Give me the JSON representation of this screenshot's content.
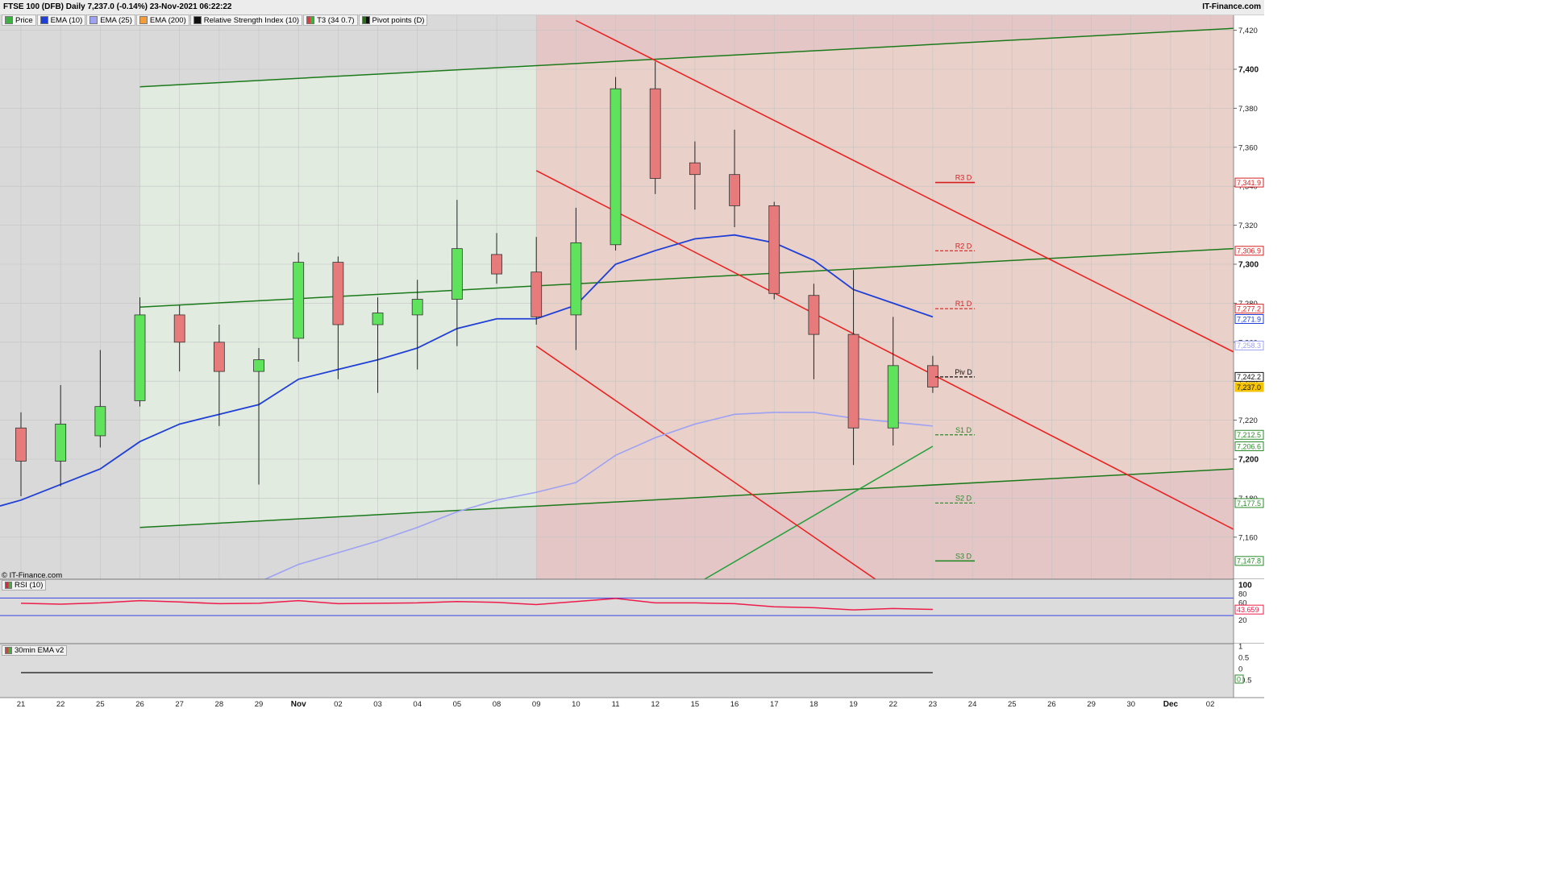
{
  "header": {
    "title": "FTSE 100 (DFB) Daily 7,237.0 (-0.14%) 23-Nov-2021 06:22:22",
    "brand": "IT-Finance.com"
  },
  "legend": [
    {
      "label": "Price",
      "color": "#3cb043"
    },
    {
      "label": "EMA (10)",
      "color": "#1f3fd6"
    },
    {
      "label": "EMA (25)",
      "color": "#9ea2f2"
    },
    {
      "label": "EMA (200)",
      "color": "#f39c3a"
    },
    {
      "label": "Relative Strength Index (10)",
      "color": "#111111"
    },
    {
      "label": "T3 (34 0.7)",
      "color": "#d64040"
    },
    {
      "label": "Pivot points (D)",
      "color": "#2a6e1a"
    }
  ],
  "copyright": "© IT-Finance.com",
  "rsi_panel_label": "RSI (10)",
  "ema_panel_label": "30min EMA v2",
  "colors": {
    "bull": "#5fe35c",
    "bear": "#e77b7b",
    "ema10": "#1f3fd6",
    "ema25": "#9ea2f2",
    "uptrend": "#1a7a1a",
    "downtrend": "#ee1c1c",
    "rsi": "#ee1c4a"
  },
  "chart_data": [
    {
      "type": "candlestick",
      "title": "FTSE 100 (DFB) Daily",
      "categories": [
        "21",
        "22",
        "25",
        "26",
        "27",
        "28",
        "29",
        "Nov",
        "02",
        "03",
        "04",
        "05",
        "08",
        "09",
        "10",
        "11",
        "12",
        "15",
        "16",
        "17",
        "18",
        "19",
        "22",
        "23",
        "24",
        "25",
        "26",
        "29",
        "30",
        "Dec",
        "02"
      ],
      "ylim": [
        7100,
        7425
      ],
      "yticks": [
        "7,160",
        "7,180",
        "7,200",
        "7,220",
        "7,240",
        "7,260",
        "7,280",
        "7,300",
        "7,320",
        "7,340",
        "7,360",
        "7,380",
        "7,400",
        "7,420"
      ],
      "candles": [
        {
          "date": "21",
          "open": 7216,
          "high": 7224,
          "low": 7181,
          "close": 7199
        },
        {
          "date": "22",
          "open": 7199,
          "high": 7238,
          "low": 7186,
          "close": 7218
        },
        {
          "date": "25",
          "open": 7212,
          "high": 7256,
          "low": 7206,
          "close": 7227
        },
        {
          "date": "26",
          "open": 7230,
          "high": 7283,
          "low": 7227,
          "close": 7274
        },
        {
          "date": "27",
          "open": 7274,
          "high": 7279,
          "low": 7245,
          "close": 7260
        },
        {
          "date": "28",
          "open": 7260,
          "high": 7269,
          "low": 7217,
          "close": 7245
        },
        {
          "date": "29",
          "open": 7245,
          "high": 7257,
          "low": 7187,
          "close": 7251
        },
        {
          "date": "Nov",
          "open": 7262,
          "high": 7306,
          "low": 7250,
          "close": 7301
        },
        {
          "date": "02",
          "open": 7301,
          "high": 7304,
          "low": 7241,
          "close": 7269
        },
        {
          "date": "03",
          "open": 7269,
          "high": 7283,
          "low": 7234,
          "close": 7275
        },
        {
          "date": "04",
          "open": 7274,
          "high": 7292,
          "low": 7246,
          "close": 7282
        },
        {
          "date": "05",
          "open": 7282,
          "high": 7333,
          "low": 7258,
          "close": 7308
        },
        {
          "date": "08",
          "open": 7305,
          "high": 7316,
          "low": 7290,
          "close": 7295
        },
        {
          "date": "09",
          "open": 7296,
          "high": 7314,
          "low": 7269,
          "close": 7273
        },
        {
          "date": "10",
          "open": 7274,
          "high": 7329,
          "low": 7256,
          "close": 7311
        },
        {
          "date": "11",
          "open": 7310,
          "high": 7396,
          "low": 7307,
          "close": 7390
        },
        {
          "date": "12",
          "open": 7390,
          "high": 7404,
          "low": 7336,
          "close": 7344
        },
        {
          "date": "15",
          "open": 7352,
          "high": 7363,
          "low": 7328,
          "close": 7346
        },
        {
          "date": "16",
          "open": 7346,
          "high": 7369,
          "low": 7319,
          "close": 7330
        },
        {
          "date": "17",
          "open": 7330,
          "high": 7332,
          "low": 7282,
          "close": 7285
        },
        {
          "date": "18",
          "open": 7284,
          "high": 7290,
          "low": 7241,
          "close": 7264
        },
        {
          "date": "19",
          "open": 7264,
          "high": 7297,
          "low": 7197,
          "close": 7216
        },
        {
          "date": "22",
          "open": 7216,
          "high": 7273,
          "low": 7207,
          "close": 7248
        },
        {
          "date": "23",
          "open": 7248,
          "high": 7253,
          "low": 7234,
          "close": 7237
        }
      ],
      "series": [
        {
          "name": "EMA (10)",
          "values": [
            7179,
            7187,
            7195,
            7209,
            7218,
            7223,
            7228,
            7241,
            7246,
            7251,
            7257,
            7267,
            7272,
            7272,
            7279,
            7300,
            7307,
            7313,
            7315,
            7311,
            7302,
            7287,
            7280,
            7273
          ]
        },
        {
          "name": "EMA (25)",
          "values": [
            7090,
            7095,
            7108,
            7117,
            7124,
            7131,
            7137,
            7146,
            7152,
            7158,
            7165,
            7173,
            7179,
            7183,
            7188,
            7202,
            7211,
            7218,
            7223,
            7224,
            7224,
            7221,
            7219,
            7217
          ]
        }
      ],
      "pivot_levels": [
        {
          "label": "R3 D",
          "value": 7341.9
        },
        {
          "label": "R2 D",
          "value": 7306.9
        },
        {
          "label": "R1 D",
          "value": 7277.2
        },
        {
          "label": "Piv D",
          "value": 7242.2
        },
        {
          "label": "S1 D",
          "value": 7212.5
        },
        {
          "label": "S2 D",
          "value": 7177.5
        },
        {
          "label": "S3 D",
          "value": 7147.8
        }
      ],
      "price_tags": [
        {
          "value": "7,341.9",
          "color": "#d62020"
        },
        {
          "value": "7,306.9",
          "color": "#d62020"
        },
        {
          "value": "7,277.2",
          "color": "#d62020"
        },
        {
          "value": "7,271.9",
          "color": "#1f3fd6"
        },
        {
          "value": "7,258.3",
          "color": "#9ea2f2"
        },
        {
          "value": "7,242.2",
          "color": "#111111"
        },
        {
          "value": "7,237.0",
          "color": "#f0c000"
        },
        {
          "value": "7,212.5",
          "color": "#2a8a2a"
        },
        {
          "value": "7,206.6",
          "color": "#2a8a2a"
        },
        {
          "value": "7,177.5",
          "color": "#2a8a2a"
        },
        {
          "value": "7,147.8",
          "color": "#2a8a2a"
        }
      ]
    },
    {
      "type": "line",
      "title": "RSI (10)",
      "ylim": [
        0,
        100
      ],
      "yticks": [
        "100",
        "80",
        "60",
        "40",
        "20"
      ],
      "reference_lines": [
        70,
        30
      ],
      "current_value": "43.659",
      "values": [
        58,
        56,
        59,
        64,
        61,
        57,
        58,
        64,
        57,
        58,
        59,
        62,
        60,
        55,
        62,
        69,
        59,
        59,
        57,
        50,
        48,
        43,
        46,
        44
      ]
    },
    {
      "type": "line",
      "title": "30min EMA v2",
      "yticks": [
        "1",
        "0.5",
        "0",
        "-0.5"
      ],
      "current_value": "0",
      "values": [
        0,
        0,
        0,
        0,
        0,
        0,
        0,
        0,
        0,
        0,
        0,
        0,
        0,
        0,
        0,
        0,
        0,
        0,
        0,
        0,
        0,
        0,
        0,
        0
      ]
    }
  ]
}
